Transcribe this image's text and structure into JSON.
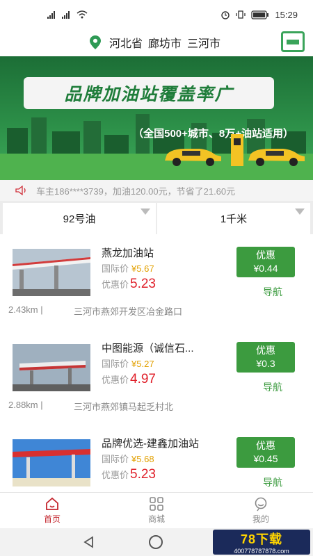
{
  "status": {
    "left_text": "46 .ıl 46 .ıl",
    "time": "15:29"
  },
  "location": {
    "province": "河北省",
    "city": "廊坊市",
    "district": "三河市"
  },
  "banner": {
    "title": "品牌加油站覆盖率广",
    "subtitle": "（全国500+城市、8万+油站适用）"
  },
  "notice": {
    "text": "车主186****3739，加油120.00元，节省了21.60元"
  },
  "filters": {
    "fuel": "92号油",
    "distance": "1千米"
  },
  "stations": [
    {
      "name": "燕龙加油站",
      "intl_label": "国际价",
      "intl_price": "¥5.67",
      "disc_label": "优惠价",
      "disc_price": "5.23",
      "badge_title": "优惠",
      "badge_value": "¥0.44",
      "nav": "导航",
      "distance": "2.43km",
      "sep": "|",
      "address": "三河市燕郊开发区冶金路口"
    },
    {
      "name": "中图能源（诚信石...",
      "intl_label": "国际价",
      "intl_price": "¥5.27",
      "disc_label": "优惠价",
      "disc_price": "4.97",
      "badge_title": "优惠",
      "badge_value": "¥0.3",
      "nav": "导航",
      "distance": "2.88km",
      "sep": "|",
      "address": "三河市燕郊镇马起乏村北"
    },
    {
      "name": "品牌优选-建鑫加油站",
      "intl_label": "国际价",
      "intl_price": "¥5.68",
      "disc_label": "优惠价",
      "disc_price": "5.23",
      "badge_title": "优惠",
      "badge_value": "¥0.45",
      "nav": "导航",
      "distance": "",
      "sep": "",
      "address": ""
    }
  ],
  "tabs": [
    {
      "label": "首页",
      "icon": "home-icon",
      "active": true
    },
    {
      "label": "商城",
      "icon": "grid-icon",
      "active": false
    },
    {
      "label": "我的",
      "icon": "user-icon",
      "active": false
    }
  ],
  "watermark": {
    "main": "78下载",
    "sub": "400778787878.com"
  },
  "colors": {
    "green": "#3c9b3f",
    "red": "#e0202a",
    "orange": "#e2a000",
    "active_tab": "#c4262e"
  }
}
